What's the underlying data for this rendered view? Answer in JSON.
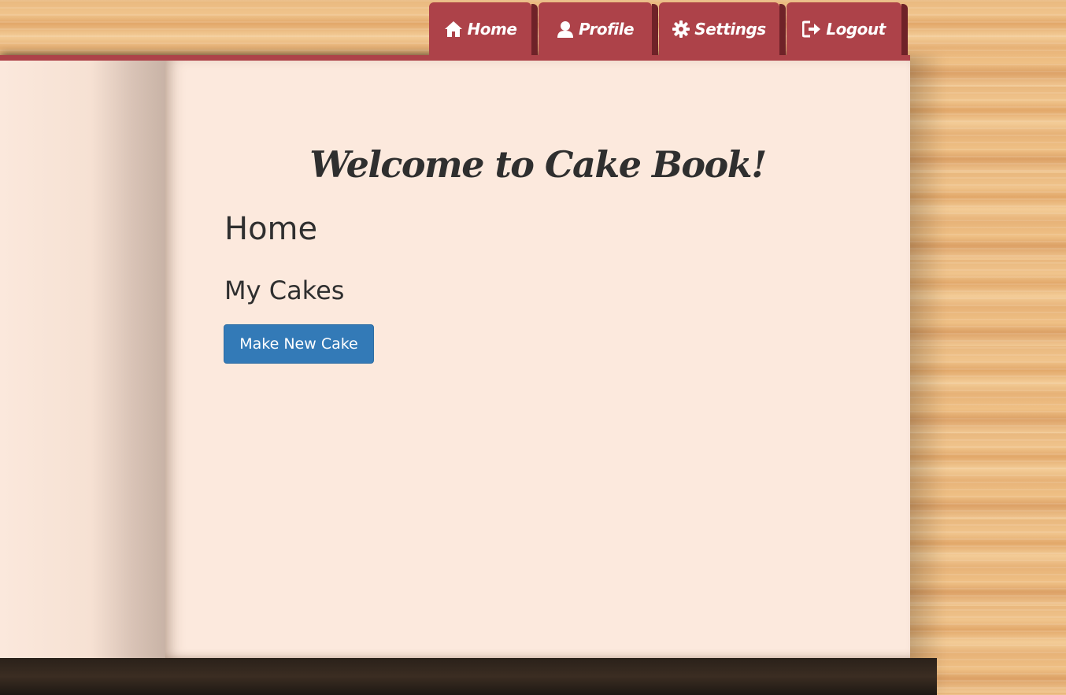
{
  "nav": {
    "tabs": [
      {
        "label": "Home",
        "icon": "home-icon"
      },
      {
        "label": "Profile",
        "icon": "user-icon"
      },
      {
        "label": "Settings",
        "icon": "gear-icon"
      },
      {
        "label": "Logout",
        "icon": "logout-icon"
      }
    ]
  },
  "main": {
    "welcome": "Welcome to Cake Book!",
    "page_title": "Home",
    "section_title": "My Cakes",
    "make_cake_button": "Make New Cake"
  },
  "colors": {
    "tab_red": "#ad4249",
    "page_cream": "#fce9dd",
    "button_blue": "#337ab7",
    "text_dark": "#2f2f2f"
  }
}
